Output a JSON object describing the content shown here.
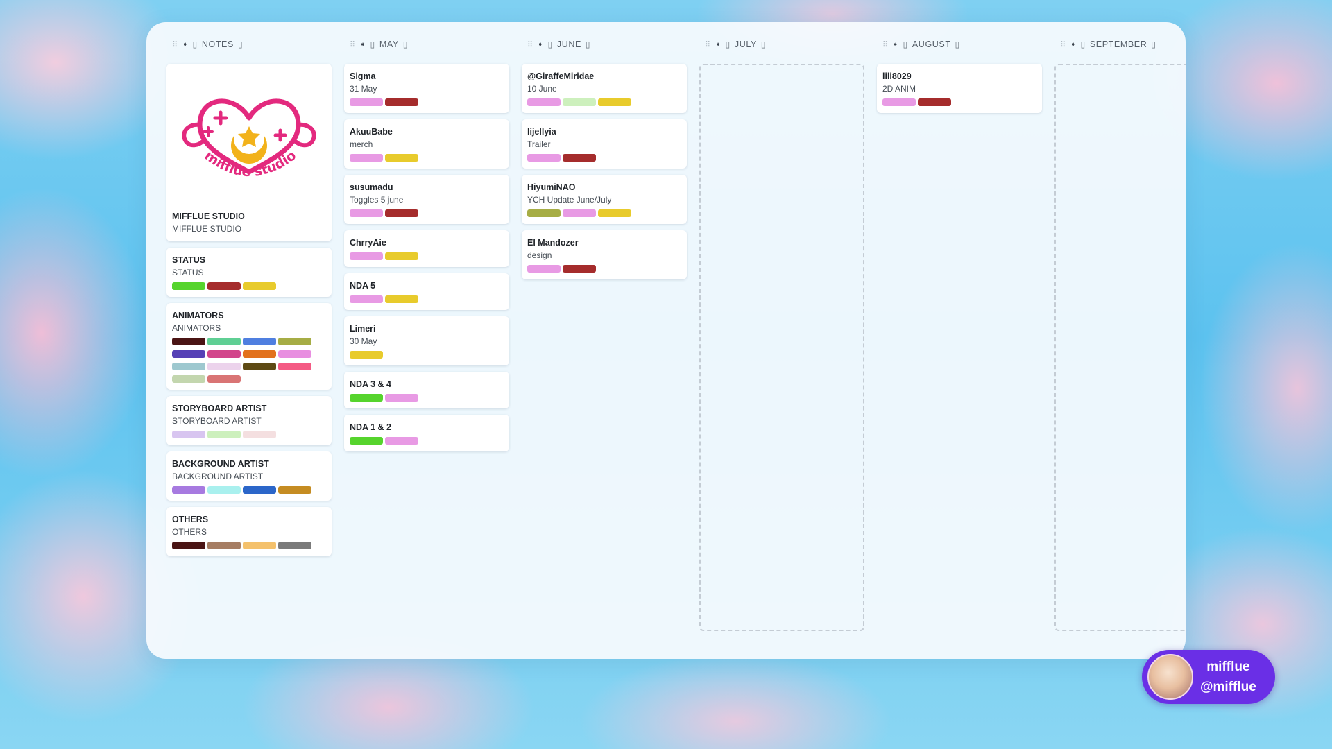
{
  "columns": [
    {
      "name": "NOTES",
      "logo_text": "mifflue studio",
      "cards": [
        {
          "title": "MIFFLUE STUDIO",
          "sub": "MIFFLUE STUDIO",
          "tags": []
        },
        {
          "title": "STATUS",
          "sub": "STATUS",
          "tags": [
            "#56d42d",
            "#a52c2c",
            "#e8cb2c"
          ]
        },
        {
          "title": "ANIMATORS",
          "sub": "ANIMATORS",
          "tags": [
            "#4a1414",
            "#5fcf94",
            "#4f7fe0",
            "#a6ad45",
            "#5641b6",
            "#d2458b",
            "#e2711d",
            "#e88ee0",
            "#9ec8cf",
            "#ecd3ec",
            "#5e4a14",
            "#f45a84",
            "#c3d6ae",
            "#d97474"
          ]
        },
        {
          "title": "STORYBOARD ARTIST",
          "sub": "STORYBOARD ARTIST",
          "tags": [
            "#d8c5f0",
            "#cdf0bd",
            "#f4dfe0"
          ]
        },
        {
          "title": "BACKGROUND ARTIST",
          "sub": "BACKGROUND ARTIST",
          "tags": [
            "#a77ae0",
            "#a9f0ee",
            "#2b66c9",
            "#c58c22"
          ]
        },
        {
          "title": "OTHERS",
          "sub": "OTHERS",
          "tags": [
            "#4a1414",
            "#a67d63",
            "#f4c16c",
            "#7a7a7a"
          ]
        }
      ]
    },
    {
      "name": "MAY",
      "cards": [
        {
          "title": "Sigma",
          "sub": "31 May",
          "tags": [
            "#e89ae4",
            "#a52c2c"
          ]
        },
        {
          "title": "AkuuBabe",
          "sub": "merch",
          "tags": [
            "#e89ae4",
            "#e8cb2c"
          ]
        },
        {
          "title": "susumadu",
          "sub": "Toggles 5 june",
          "tags": [
            "#e89ae4",
            "#a52c2c"
          ]
        },
        {
          "title": "ChrryAie",
          "sub": "",
          "tags": [
            "#e89ae4",
            "#e8cb2c"
          ]
        },
        {
          "title": "NDA 5",
          "sub": "",
          "tags": [
            "#e89ae4",
            "#e8cb2c"
          ]
        },
        {
          "title": "Limeri",
          "sub": "30 May",
          "tags": [
            "#e8cb2c"
          ]
        },
        {
          "title": "NDA 3 & 4",
          "sub": "",
          "tags": [
            "#56d42d",
            "#e89ae4"
          ]
        },
        {
          "title": "NDA 1 & 2",
          "sub": "",
          "tags": [
            "#56d42d",
            "#e89ae4"
          ]
        }
      ]
    },
    {
      "name": "JUNE",
      "cards": [
        {
          "title": "@GiraffeMiridae",
          "sub": "10 June",
          "tags": [
            "#e89ae4",
            "#cdf0bd",
            "#e8cb2c"
          ]
        },
        {
          "title": "lijellyia",
          "sub": "Trailer",
          "tags": [
            "#e89ae4",
            "#a52c2c"
          ]
        },
        {
          "title": "HiyumiNAO",
          "sub": "YCH Update June/July",
          "tags": [
            "#a6ad45",
            "#e89ae4",
            "#e8cb2c"
          ]
        },
        {
          "title": "El Mandozer",
          "sub": "design",
          "tags": [
            "#e89ae4",
            "#a52c2c"
          ]
        }
      ]
    },
    {
      "name": "JULY",
      "cards": []
    },
    {
      "name": "AUGUST",
      "cards": [
        {
          "title": "lili8029",
          "sub": "2D ANIM",
          "tags": [
            "#e89ae4",
            "#a52c2c"
          ]
        }
      ]
    },
    {
      "name": "SEPTEMBER",
      "cards": []
    }
  ],
  "badge": {
    "name": "mifflue",
    "handle": "@mifflue"
  }
}
